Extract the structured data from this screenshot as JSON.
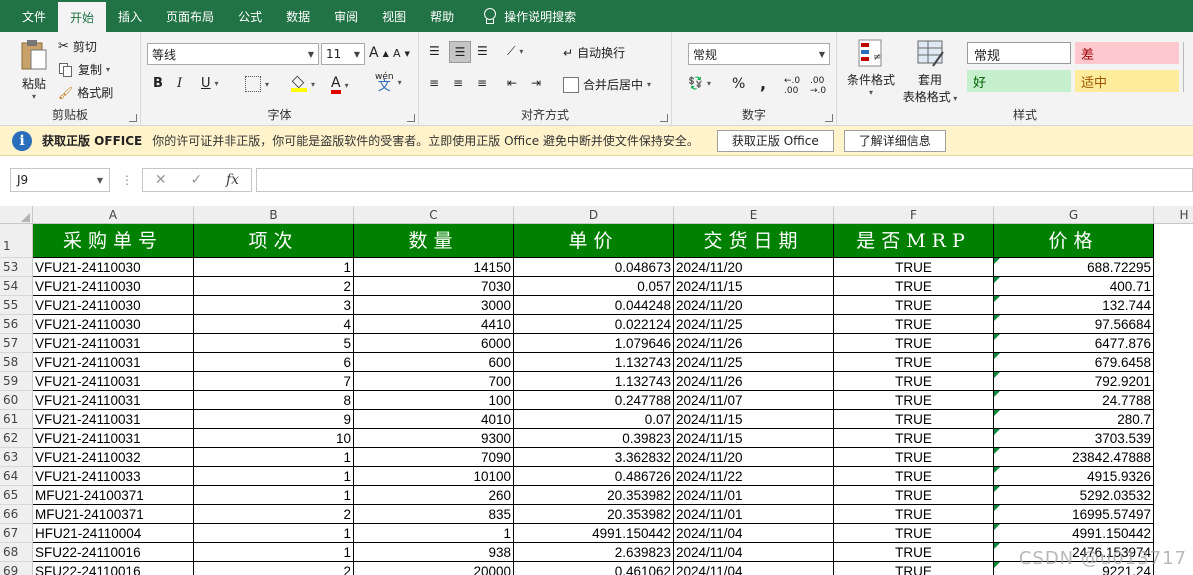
{
  "tabs": [
    "文件",
    "开始",
    "插入",
    "页面布局",
    "公式",
    "数据",
    "审阅",
    "视图",
    "帮助"
  ],
  "active_tab": "开始",
  "tell_me": "操作说明搜索",
  "ribbon": {
    "clipboard": {
      "paste": "粘贴",
      "cut": "剪切",
      "copy": "复制",
      "format_painter": "格式刷",
      "label": "剪贴板"
    },
    "font": {
      "name": "等线",
      "size": "11",
      "label": "字体",
      "bold": "B",
      "italic": "I",
      "underline": "U",
      "grow": "A",
      "shrink": "A",
      "font_color": "A",
      "phonetic": "wén"
    },
    "alignment": {
      "wrap": "自动换行",
      "merge": "合并后居中",
      "label": "对齐方式"
    },
    "number": {
      "format": "常规",
      "percent": "%",
      "comma": ",",
      "label": "数字"
    },
    "styles": {
      "conditional": "条件格式",
      "table_format": "套用",
      "table_format2": "表格格式",
      "normal": "常规",
      "bad": "差",
      "good": "好",
      "neutral": "适中",
      "label": "样式"
    }
  },
  "license": {
    "title": "获取正版 OFFICE",
    "message": "你的许可证并非正版，你可能是盗版软件的受害者。立即使用正版 Office 避免中断并使文件保持安全。",
    "btn_get": "获取正版 Office",
    "btn_more": "了解详细信息"
  },
  "formula": {
    "name_box": "J9",
    "fx": "fx",
    "cancel": "✕",
    "enter": "✓"
  },
  "colors": {
    "ribbon_green": "#217346",
    "header_green": "#008000",
    "license_bg": "#fff3cc",
    "bad_bg": "#ffc7ce",
    "good_bg": "#c6efce",
    "neutral_bg": "#ffeb9c"
  },
  "columns": [
    "A",
    "B",
    "C",
    "D",
    "E",
    "F",
    "G",
    "H"
  ],
  "header_row_number": "1",
  "headers": [
    "采购单号",
    "项次",
    "数量",
    "单价",
    "交货日期",
    "是否MRP",
    "价格"
  ],
  "rows": [
    {
      "n": "53",
      "po": "VFU21-24110030",
      "item": "1",
      "qty": "14150",
      "price": "0.048673",
      "date": "2024/11/20",
      "mrp": "TRUE",
      "amount": "688.72295"
    },
    {
      "n": "54",
      "po": "VFU21-24110030",
      "item": "2",
      "qty": "7030",
      "price": "0.057",
      "date": "2024/11/15",
      "mrp": "TRUE",
      "amount": "400.71"
    },
    {
      "n": "55",
      "po": "VFU21-24110030",
      "item": "3",
      "qty": "3000",
      "price": "0.044248",
      "date": "2024/11/20",
      "mrp": "TRUE",
      "amount": "132.744"
    },
    {
      "n": "56",
      "po": "VFU21-24110030",
      "item": "4",
      "qty": "4410",
      "price": "0.022124",
      "date": "2024/11/25",
      "mrp": "TRUE",
      "amount": "97.56684"
    },
    {
      "n": "57",
      "po": "VFU21-24110031",
      "item": "5",
      "qty": "6000",
      "price": "1.079646",
      "date": "2024/11/26",
      "mrp": "TRUE",
      "amount": "6477.876"
    },
    {
      "n": "58",
      "po": "VFU21-24110031",
      "item": "6",
      "qty": "600",
      "price": "1.132743",
      "date": "2024/11/25",
      "mrp": "TRUE",
      "amount": "679.6458"
    },
    {
      "n": "59",
      "po": "VFU21-24110031",
      "item": "7",
      "qty": "700",
      "price": "1.132743",
      "date": "2024/11/26",
      "mrp": "TRUE",
      "amount": "792.9201"
    },
    {
      "n": "60",
      "po": "VFU21-24110031",
      "item": "8",
      "qty": "100",
      "price": "0.247788",
      "date": "2024/11/07",
      "mrp": "TRUE",
      "amount": "24.7788"
    },
    {
      "n": "61",
      "po": "VFU21-24110031",
      "item": "9",
      "qty": "4010",
      "price": "0.07",
      "date": "2024/11/15",
      "mrp": "TRUE",
      "amount": "280.7"
    },
    {
      "n": "62",
      "po": "VFU21-24110031",
      "item": "10",
      "qty": "9300",
      "price": "0.39823",
      "date": "2024/11/15",
      "mrp": "TRUE",
      "amount": "3703.539"
    },
    {
      "n": "63",
      "po": "VFU21-24110032",
      "item": "1",
      "qty": "7090",
      "price": "3.362832",
      "date": "2024/11/20",
      "mrp": "TRUE",
      "amount": "23842.47888"
    },
    {
      "n": "64",
      "po": "VFU21-24110033",
      "item": "1",
      "qty": "10100",
      "price": "0.486726",
      "date": "2024/11/22",
      "mrp": "TRUE",
      "amount": "4915.9326"
    },
    {
      "n": "65",
      "po": "MFU21-24100371",
      "item": "1",
      "qty": "260",
      "price": "20.353982",
      "date": "2024/11/01",
      "mrp": "TRUE",
      "amount": "5292.03532"
    },
    {
      "n": "66",
      "po": "MFU21-24100371",
      "item": "2",
      "qty": "835",
      "price": "20.353982",
      "date": "2024/11/01",
      "mrp": "TRUE",
      "amount": "16995.57497"
    },
    {
      "n": "67",
      "po": "HFU21-24110004",
      "item": "1",
      "qty": "1",
      "price": "4991.150442",
      "date": "2024/11/04",
      "mrp": "TRUE",
      "amount": "4991.150442"
    },
    {
      "n": "68",
      "po": "SFU22-24110016",
      "item": "1",
      "qty": "938",
      "price": "2.639823",
      "date": "2024/11/04",
      "mrp": "TRUE",
      "amount": "2476.153974"
    },
    {
      "n": "69",
      "po": "SFU22-24110016",
      "item": "2",
      "qty": "20000",
      "price": "0.461062",
      "date": "2024/11/04",
      "mrp": "TRUE",
      "amount": "9221.24"
    }
  ],
  "watermark": "CSDN @u013717"
}
